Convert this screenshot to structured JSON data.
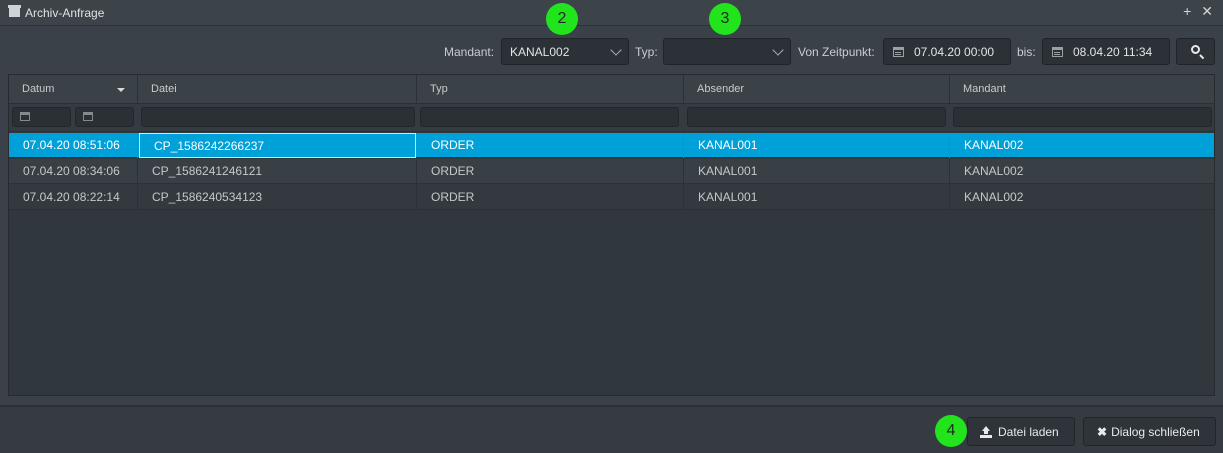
{
  "window": {
    "title": "Archiv-Anfrage",
    "add_glyph": "+",
    "close_glyph": "✕"
  },
  "toolbar": {
    "mandant_label": "Mandant:",
    "mandant_value": "KANAL002",
    "typ_label": "Typ:",
    "typ_value": "",
    "von_label": "Von Zeitpunkt:",
    "von_value": "07.04.20 00:00",
    "bis_label": "bis:",
    "bis_value": "08.04.20 11:34"
  },
  "badges": [
    "2",
    "3",
    "4"
  ],
  "table": {
    "columns": [
      "Datum",
      "Datei",
      "Typ",
      "Absender",
      "Mandant"
    ],
    "rows": [
      [
        "07.04.20 08:51:06",
        "CP_1586242266237",
        "ORDER",
        "KANAL001",
        "KANAL002"
      ],
      [
        "07.04.20 08:34:06",
        "CP_1586241246121",
        "ORDER",
        "KANAL001",
        "KANAL002"
      ],
      [
        "07.04.20 08:22:14",
        "CP_1586240534123",
        "ORDER",
        "KANAL001",
        "KANAL002"
      ]
    ]
  },
  "footer": {
    "load_label": "Datei laden",
    "close_label": "Dialog schließen"
  },
  "icons": [
    "window-icon",
    "calendar-icon",
    "search-icon",
    "upload-icon",
    "close-icon",
    "chevron-down-icon"
  ],
  "colors": {
    "selection": "#00a0d8",
    "badge": "#22e41c"
  }
}
